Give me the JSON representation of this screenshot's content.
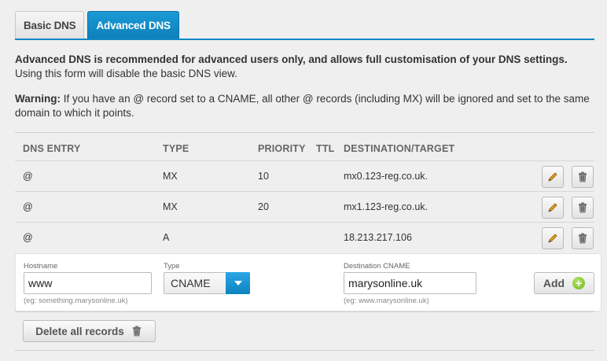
{
  "tabs": [
    {
      "label": "Basic DNS",
      "active": false
    },
    {
      "label": "Advanced DNS",
      "active": true
    }
  ],
  "intro": {
    "bold": "Advanced DNS is recommended for advanced users only, and allows full customisation of your DNS settings.",
    "normal": "Using this form will disable the basic DNS view."
  },
  "warning": {
    "label": "Warning:",
    "text": "If you have an @ record set to a CNAME, all other @ records (including MX) will be ignored and set to the same domain to which it points."
  },
  "table": {
    "headers": [
      "DNS ENTRY",
      "TYPE",
      "PRIORITY",
      "TTL",
      "DESTINATION/TARGET"
    ],
    "rows": [
      {
        "entry": "@",
        "type": "MX",
        "priority": "10",
        "ttl": "",
        "destination": "mx0.123-reg.co.uk."
      },
      {
        "entry": "@",
        "type": "MX",
        "priority": "20",
        "ttl": "",
        "destination": "mx1.123-reg.co.uk."
      },
      {
        "entry": "@",
        "type": "A",
        "priority": "",
        "ttl": "",
        "destination": "18.213.217.106"
      }
    ]
  },
  "add_form": {
    "hostname_label": "Hostname",
    "hostname_value": "www",
    "hostname_hint": "(eg: something.marysonline.uk)",
    "type_label": "Type",
    "type_value": "CNAME",
    "destination_label": "Destination CNAME",
    "destination_value": "marysonline.uk",
    "destination_hint": "(eg: www.marysonline.uk)",
    "add_label": "Add"
  },
  "delete_all_label": "Delete all records",
  "icons": {
    "edit": "pencil-icon",
    "delete": "trash-icon",
    "add": "plus-circle-icon",
    "dropdown": "chevron-down-icon"
  },
  "colors": {
    "accent": "#1088c4",
    "add_green": "#6cb81f"
  }
}
